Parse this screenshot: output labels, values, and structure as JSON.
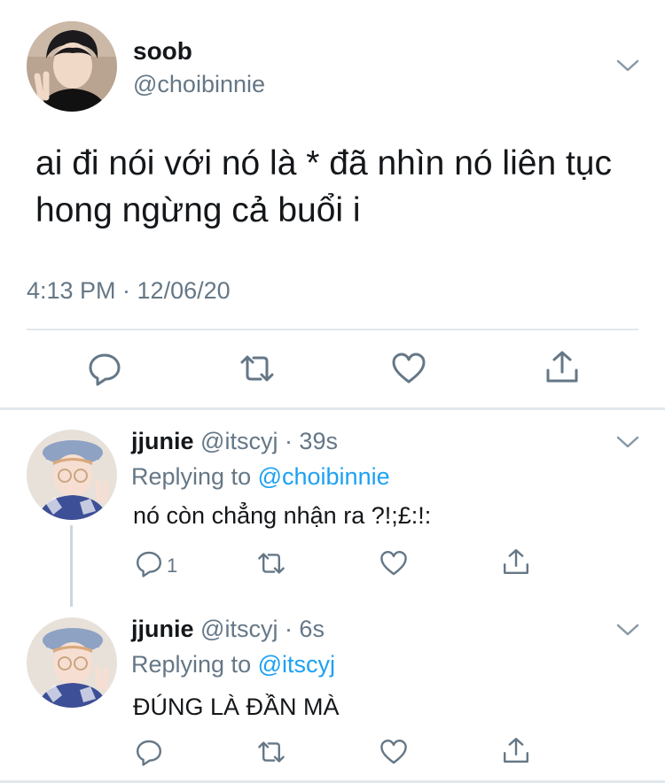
{
  "main_tweet": {
    "display_name": "soob",
    "handle": "@choibinnie",
    "text": "ai đi nói với nó là * đã nhìn nó liên tục hong ngừng cả buổi i",
    "timestamp": "4:13 PM · 12/06/20",
    "actions": [
      "reply-icon",
      "retweet-icon",
      "like-icon",
      "share-icon"
    ]
  },
  "replies": [
    {
      "display_name": "jjunie",
      "meta": "@itscyj · 39s",
      "replying_prefix": "Replying to ",
      "replying_to": "@choibinnie",
      "text": "nó còn chẳng nhận ra ?!;£:!:",
      "reply_count": "1"
    },
    {
      "display_name": "jjunie",
      "meta": "@itscyj · 6s",
      "replying_prefix": "Replying to ",
      "replying_to": "@itscyj",
      "text": "ĐÚNG LÀ ĐẦN MÀ",
      "reply_count": ""
    }
  ],
  "colors": {
    "accent": "#1da1f2",
    "secondary_text": "#657786",
    "divider": "#e1e8ed"
  }
}
